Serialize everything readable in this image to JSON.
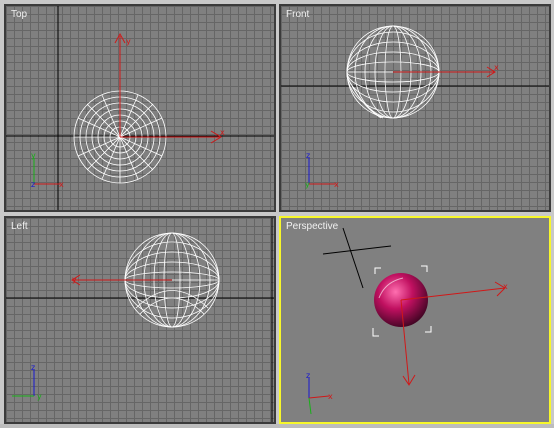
{
  "viewports": {
    "top": {
      "label": "Top"
    },
    "front": {
      "label": "Front"
    },
    "left": {
      "label": "Left"
    },
    "perspective": {
      "label": "Perspective"
    }
  },
  "axis_labels": {
    "x": "x",
    "y": "y",
    "z": "z"
  },
  "colors": {
    "viewport_bg": "#808080",
    "active_border": "#f7f72a",
    "axis_red": "#d01818",
    "axis_green": "#18b018",
    "axis_blue": "#1818d0",
    "wire": "#ffffff",
    "sphere_shaded": "#c01060"
  }
}
